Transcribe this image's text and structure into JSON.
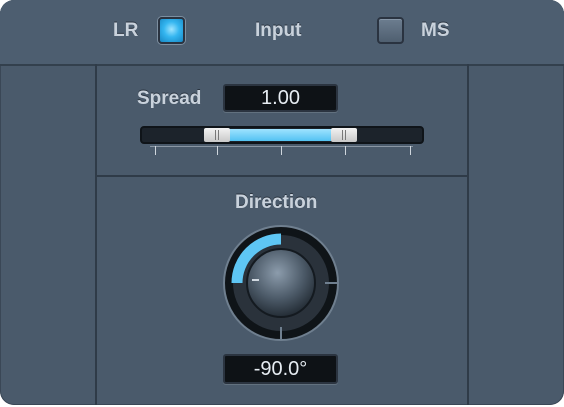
{
  "input": {
    "lr_label": "LR",
    "lr_checked": true,
    "title": "Input",
    "ms_label": "MS",
    "ms_checked": false
  },
  "spread": {
    "label": "Spread",
    "value": "1.00",
    "range_low": 0.25,
    "range_high": 0.75
  },
  "direction": {
    "label": "Direction",
    "value": "-90.0°"
  },
  "colors": {
    "panel": "#4a5a6b",
    "accent": "#34b6f0",
    "value_bg": "#0e1216"
  }
}
